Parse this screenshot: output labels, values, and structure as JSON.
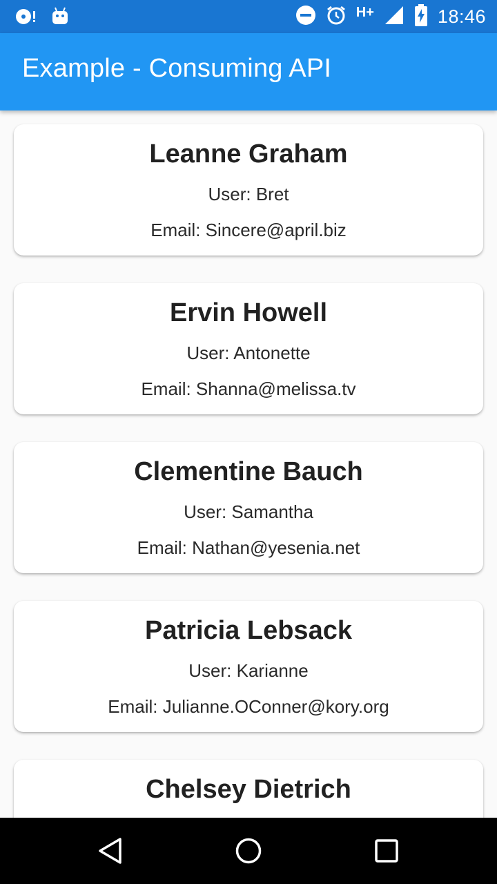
{
  "status_bar": {
    "time": "18:46",
    "network": "H+",
    "icons": [
      "disc-notification-icon",
      "android-notification-icon",
      "do-not-disturb-icon",
      "alarm-icon",
      "signal-icon",
      "battery-charging-icon"
    ]
  },
  "app_bar": {
    "title": "Example - Consuming API",
    "color": "#2196f3"
  },
  "users": [
    {
      "name": "Leanne Graham",
      "user": "User: Bret",
      "email": "Email: Sincere@april.biz"
    },
    {
      "name": "Ervin Howell",
      "user": "User: Antonette",
      "email": "Email: Shanna@melissa.tv"
    },
    {
      "name": "Clementine Bauch",
      "user": "User: Samantha",
      "email": "Email: Nathan@yesenia.net"
    },
    {
      "name": "Patricia Lebsack",
      "user": "User: Karianne",
      "email": "Email: Julianne.OConner@kory.org"
    },
    {
      "name": "Chelsey Dietrich",
      "user": "",
      "email": ""
    }
  ],
  "nav_bar": {
    "icons": [
      "back-icon",
      "home-icon",
      "recents-icon"
    ]
  }
}
